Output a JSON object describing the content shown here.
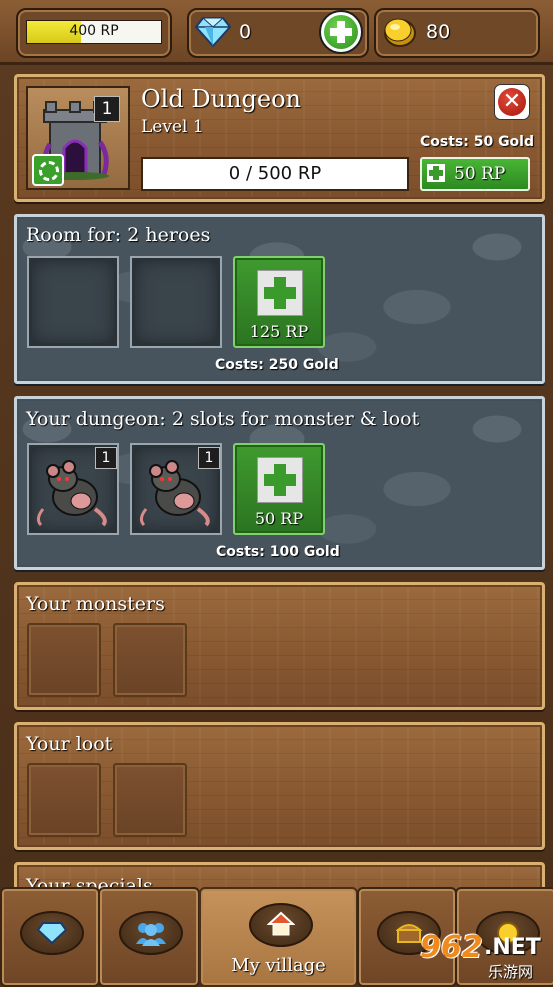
{
  "topbar": {
    "rp_text": "400 RP",
    "rp_progress": 0.4,
    "gems": "0",
    "gold": "80"
  },
  "header": {
    "name": "Old Dungeon",
    "level": "Level 1",
    "badge": "1",
    "progress_text": "0 / 500 RP",
    "cost": "Costs: 50 Gold",
    "upgrade_label": "50 RP"
  },
  "heroes": {
    "title": "Room for: 2 heroes",
    "add_label": "125 RP",
    "cost": "Costs: 250 Gold"
  },
  "dungeon": {
    "title": "Your dungeon: 2 slots for monster & loot",
    "slot_badges": [
      "1",
      "1"
    ],
    "add_label": "50 RP",
    "cost": "Costs: 100 Gold"
  },
  "monsters": {
    "title": "Your monsters"
  },
  "loot": {
    "title": "Your loot"
  },
  "specials": {
    "title": "Your specials"
  },
  "nav": {
    "items": [
      {
        "name": "gems-tab",
        "icon": "gem-icon",
        "label": ""
      },
      {
        "name": "heroes-tab",
        "icon": "people-icon",
        "label": ""
      },
      {
        "name": "village-tab",
        "icon": "house-icon",
        "label": "My village"
      },
      {
        "name": "treasure-tab",
        "icon": "chest-icon",
        "label": ""
      },
      {
        "name": "gold-tab",
        "icon": "coin-icon",
        "label": ""
      }
    ]
  },
  "watermark": {
    "brand": "962",
    "suffix": ".NET",
    "sub": "乐游网"
  },
  "colors": {
    "green": "#3f9a2f",
    "gold": "#e8b81c",
    "gem": "#6fd0f0"
  }
}
